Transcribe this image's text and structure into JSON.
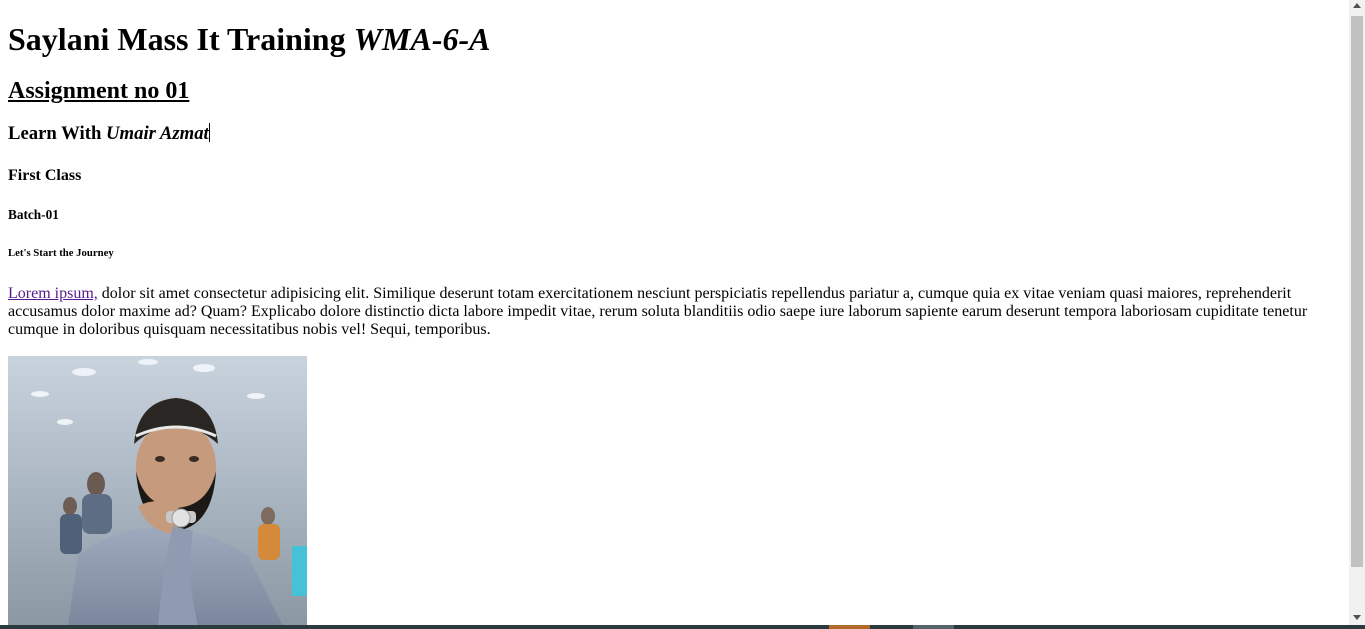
{
  "heading1": {
    "text": "Saylani Mass It Training ",
    "emphasis": "WMA-6-A"
  },
  "heading2": {
    "text": "Assignment no 01"
  },
  "heading3": {
    "text": "Learn With ",
    "emphasis": "Umair Azmat"
  },
  "heading4": {
    "text": "First Class"
  },
  "heading5": {
    "text": "Batch-01"
  },
  "heading6": {
    "text": "Let's Start the Journey"
  },
  "paragraph": {
    "link_text": "Lorem ipsum,",
    "body": " dolor sit amet consectetur adipisicing elit. Similique deserunt totam exercitationem nesciunt perspiciatis repellendus pariatur a, cumque quia ex vitae veniam quasi maiores, reprehenderit accusamus dolor maxime ad? Quam? Explicabo dolore distinctio dicta labore impedit vitae, rerum soluta blanditiis odio saepe iure laborum sapiente earum deserunt tempora laboriosam cupiditate tenetur cumque in doloribus quisquam necessitatibus nobis vel! Sequi, temporibus."
  },
  "photo": {
    "icon": "portrait-photo"
  },
  "colors": {
    "link": "#551a8b",
    "scroll_thumb": "#c1c1c1",
    "taskbar": "#2b3a3e"
  }
}
